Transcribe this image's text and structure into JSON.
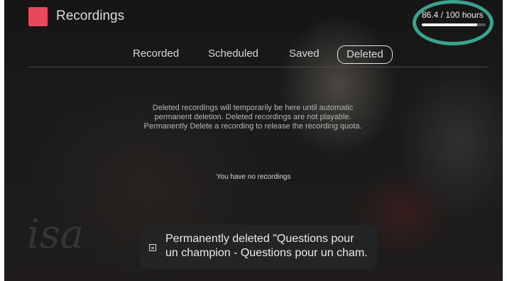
{
  "header": {
    "title": "Recordings",
    "brand_color": "#e8495a",
    "quota_text": "86.4 / 100 hours",
    "quota_used_fraction": 0.864
  },
  "tabs": [
    {
      "label": "Recorded",
      "active": false
    },
    {
      "label": "Scheduled",
      "active": false
    },
    {
      "label": "Saved",
      "active": false
    },
    {
      "label": "Deleted",
      "active": true
    }
  ],
  "info_text": "Deleted recordings will temporarily be here until automatic permanent deletion. Deleted recordings are not playable. Permanently Delete a recording to release the recording quota.",
  "info_lines": [
    "Deleted recordings will temporarily be here until automatic",
    "permanent deletion. Deleted recordings are not playable.",
    "Permanently Delete a recording to release the recording quota."
  ],
  "empty_message": "You have no recordings",
  "toast": {
    "icon": "message-icon",
    "line1": "Permanently deleted \"Questions pour",
    "line2": "un champion - Questions pour un cham.."
  },
  "background_watermark": "isa",
  "highlight_color": "#3aa28e"
}
